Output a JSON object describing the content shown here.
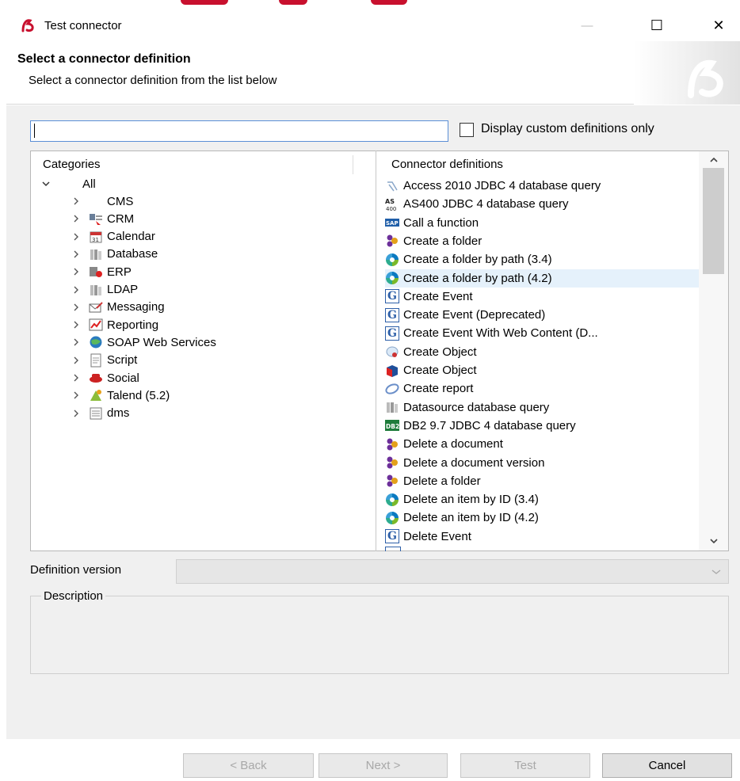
{
  "window": {
    "title": "Test connector",
    "minimize_label": "—",
    "maximize_label": "☐",
    "close_label": "✕"
  },
  "header": {
    "title": "Select a connector definition",
    "subtitle": "Select a connector definition from the list below"
  },
  "search": {
    "value": "",
    "placeholder": ""
  },
  "custom_only": {
    "label": "Display custom definitions only",
    "checked": false
  },
  "categories": {
    "header": "Categories",
    "root": "All",
    "items": [
      {
        "label": "CMS",
        "icon": "none"
      },
      {
        "label": "CRM",
        "icon": "crm-icon"
      },
      {
        "label": "Calendar",
        "icon": "calendar-icon"
      },
      {
        "label": "Database",
        "icon": "database-icon"
      },
      {
        "label": "ERP",
        "icon": "erp-icon"
      },
      {
        "label": "LDAP",
        "icon": "ldap-icon"
      },
      {
        "label": "Messaging",
        "icon": "messaging-icon"
      },
      {
        "label": "Reporting",
        "icon": "reporting-icon"
      },
      {
        "label": "SOAP Web Services",
        "icon": "globe-icon"
      },
      {
        "label": "Script",
        "icon": "script-icon"
      },
      {
        "label": "Social",
        "icon": "social-icon"
      },
      {
        "label": "Talend (5.2)",
        "icon": "talend-icon"
      },
      {
        "label": "dms",
        "icon": "dms-icon"
      }
    ]
  },
  "definitions": {
    "header": "Connector definitions",
    "selected_index": 5,
    "items": [
      {
        "label": "Access 2010 JDBC 4 database query",
        "icon": "access-icon"
      },
      {
        "label": "AS400 JDBC 4 database query",
        "icon": "as400-icon"
      },
      {
        "label": "Call a function",
        "icon": "sap-icon"
      },
      {
        "label": "Create a folder",
        "icon": "cmis-icon"
      },
      {
        "label": "Create a folder by path (3.4)",
        "icon": "alfresco-icon"
      },
      {
        "label": "Create a folder by path (4.2)",
        "icon": "alfresco-icon"
      },
      {
        "label": "Create Event",
        "icon": "google-calendar-icon"
      },
      {
        "label": "Create Event (Deprecated)",
        "icon": "google-calendar-icon"
      },
      {
        "label": "Create Event With Web Content (D...",
        "icon": "google-calendar-icon"
      },
      {
        "label": "Create Object",
        "icon": "object-icon"
      },
      {
        "label": "Create Object",
        "icon": "cube-icon"
      },
      {
        "label": "Create report",
        "icon": "report-icon"
      },
      {
        "label": "Datasource database query",
        "icon": "database-icon"
      },
      {
        "label": "DB2 9.7 JDBC 4 database query",
        "icon": "db2-icon"
      },
      {
        "label": "Delete a document",
        "icon": "cmis-icon"
      },
      {
        "label": "Delete a document version",
        "icon": "cmis-icon"
      },
      {
        "label": "Delete a folder",
        "icon": "cmis-icon"
      },
      {
        "label": "Delete an item by ID (3.4)",
        "icon": "alfresco-icon"
      },
      {
        "label": "Delete an item by ID (4.2)",
        "icon": "alfresco-icon"
      },
      {
        "label": "Delete Event",
        "icon": "google-calendar-icon"
      }
    ]
  },
  "definition_version": {
    "label": "Definition version",
    "value": ""
  },
  "description": {
    "label": "Description",
    "text": ""
  },
  "buttons": {
    "back": "< Back",
    "next": "Next >",
    "test": "Test",
    "cancel": "Cancel"
  },
  "colors": {
    "brand": "#c8102e",
    "selection": "#e5f1fb",
    "focus_border": "#5b8fd6"
  }
}
